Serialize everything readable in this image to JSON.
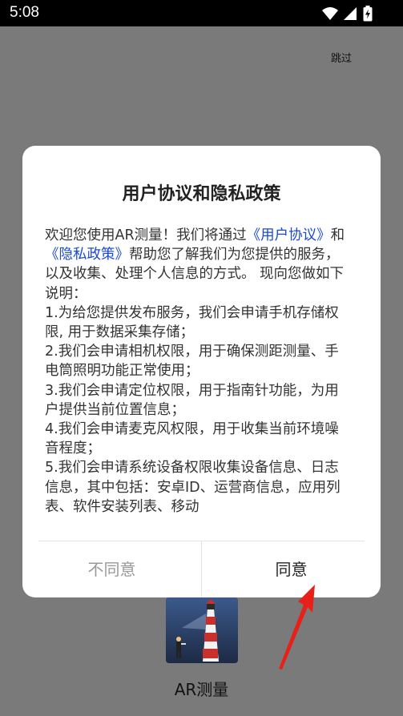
{
  "status_bar": {
    "time": "5:08",
    "icons": [
      "wifi-icon",
      "signal-icon",
      "battery-charging-icon"
    ]
  },
  "skip_label": "跳过",
  "app": {
    "name": "AR测量",
    "icon": "lighthouse-app-icon"
  },
  "dialog": {
    "title": "用户协议和隐私政策",
    "intro": {
      "t1": "欢迎您使用AR测量！我们将通过",
      "link1": "《用户协议》",
      "t2": "和",
      "link2": "《隐私政策》",
      "t3": "帮助您了解我们为您提供的服务，以及收集、处理个人信息的方式。 现向您做如下说明："
    },
    "items": [
      "1.为给您提供发布服务，我们会申请手机存储权限, 用于数据采集存储；",
      "2.我们会申请相机权限，用于确保测距测量、手电筒照明功能正常使用；",
      "3.我们会申请定位权限，用于指南针功能，为用户提供当前位置信息；",
      "4.我们会申请麦克风权限，用于收集当前环境噪音程度；",
      "5.我们会申请系统设备权限收集设备信息、日志信息，其中包括：安卓ID、运营商信息，应用列表、软件安装列表、移动"
    ],
    "buttons": {
      "disagree": "不同意",
      "agree": "同意"
    }
  },
  "colors": {
    "link": "#1a48d6",
    "dim_overlay": "#7a7a7a",
    "arrow": "#e8201a"
  }
}
